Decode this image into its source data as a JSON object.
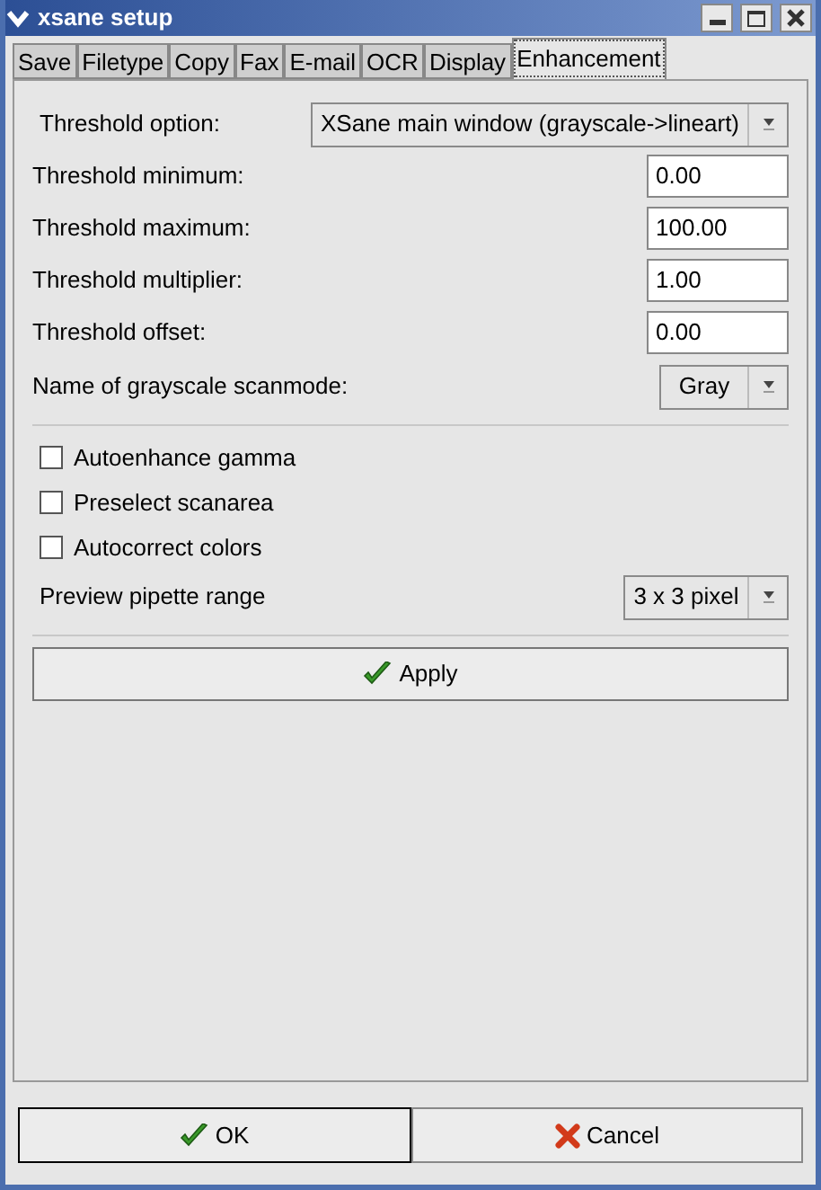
{
  "window": {
    "title": "xsane setup"
  },
  "tabs": [
    {
      "label": "Save",
      "selected": false
    },
    {
      "label": "Filetype",
      "selected": false
    },
    {
      "label": "Copy",
      "selected": false
    },
    {
      "label": "Fax",
      "selected": false
    },
    {
      "label": "E-mail",
      "selected": false
    },
    {
      "label": "OCR",
      "selected": false
    },
    {
      "label": "Display",
      "selected": false
    },
    {
      "label": "Enhancement",
      "selected": true
    }
  ],
  "threshold_option": {
    "label": "Threshold option:",
    "value": "XSane main window (grayscale->lineart)"
  },
  "fields": [
    {
      "label": "Threshold minimum:",
      "value": "0.00"
    },
    {
      "label": "Threshold maximum:",
      "value": "100.00"
    },
    {
      "label": "Threshold multiplier:",
      "value": "1.00"
    },
    {
      "label": "Threshold offset:",
      "value": "0.00"
    }
  ],
  "grayscale_scanmode": {
    "label": "Name of grayscale scanmode:",
    "value": "Gray"
  },
  "checkboxes": [
    {
      "label": "Autoenhance gamma",
      "checked": false
    },
    {
      "label": "Preselect scanarea",
      "checked": false
    },
    {
      "label": "Autocorrect colors",
      "checked": false
    }
  ],
  "pipette_range": {
    "label": "Preview pipette range",
    "value": "3 x 3 pixel"
  },
  "apply_button": "Apply",
  "buttons": [
    {
      "label": "OK",
      "kind": "ok"
    },
    {
      "label": "Cancel",
      "kind": "cancel"
    }
  ]
}
